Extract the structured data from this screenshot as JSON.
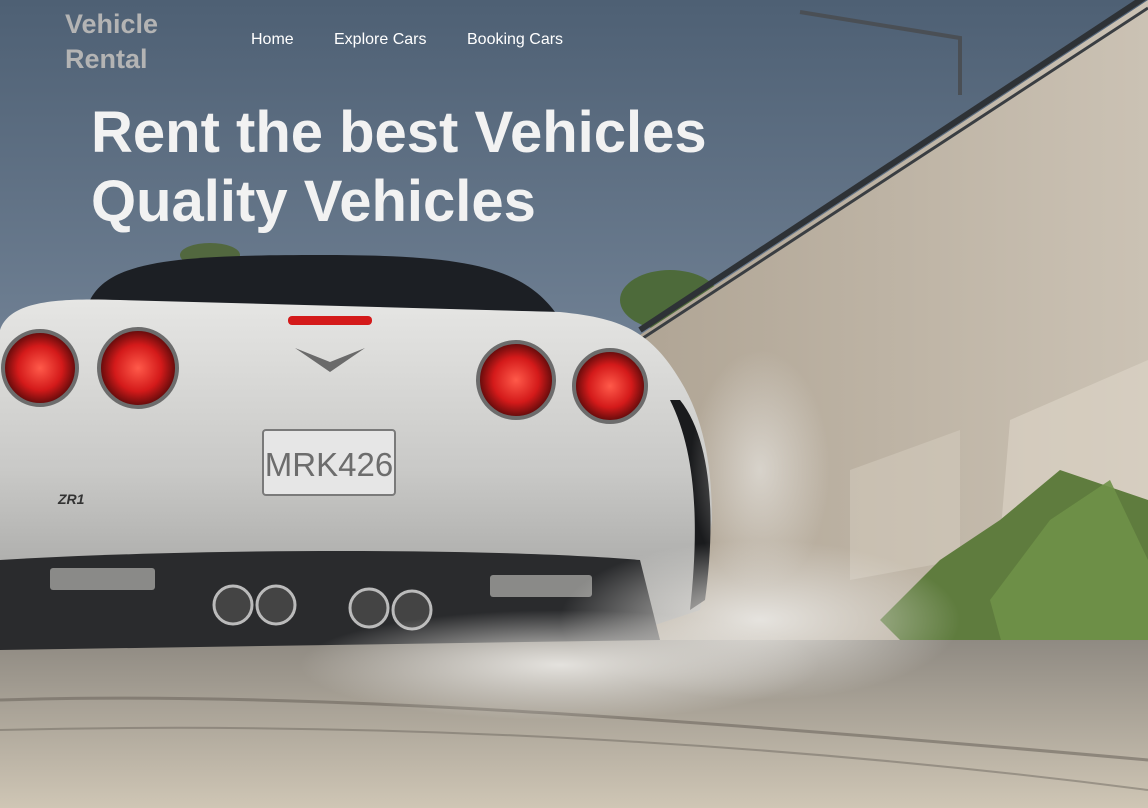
{
  "brand": {
    "line1": "Vehicle",
    "line2": "Rental"
  },
  "nav": {
    "items": [
      "Home",
      "Explore Cars",
      "Booking Cars"
    ]
  },
  "hero": {
    "headline_line1": "Rent the best Vehicles",
    "headline_line2": "Quality Vehicles",
    "license_plate": "MRK426",
    "badge_text": "ZR1",
    "image_subject": "car-rear-photo"
  },
  "colors": {
    "sky": "#5d6f83",
    "brand_text": "#b4b4b4",
    "headline": "#f2f2f2",
    "car_body": "#c9c9c7",
    "taillight": "#d41a1a"
  }
}
